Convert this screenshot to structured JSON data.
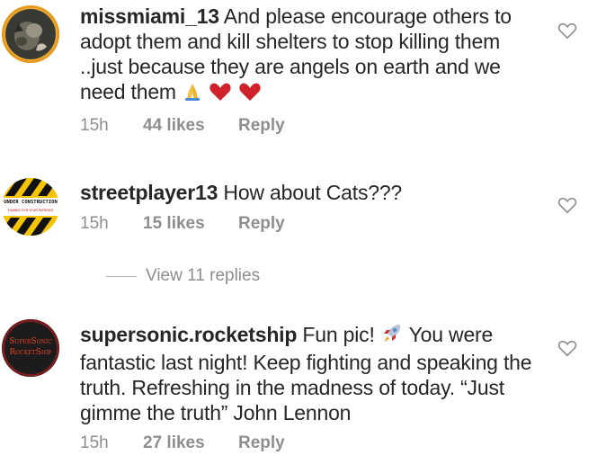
{
  "comments": [
    {
      "username": "missmiami_13",
      "text": "And please encourage others to adopt them and kill shelters to stop killing them ..just because they are angels on earth and we need them",
      "emojis": [
        "folded-hands-icon",
        "red-heart-icon",
        "red-heart-icon"
      ],
      "time": "15h",
      "likes": "44 likes",
      "reply": "Reply"
    },
    {
      "username": "streetplayer13",
      "text": "How about Cats???",
      "avatar_text_top": "UNDER CONSTRUCTION",
      "avatar_text_bottom": "THANKS FOR YOUR PATIENCE",
      "time": "15h",
      "likes": "15 likes",
      "reply": "Reply",
      "view_replies": "View 11 replies"
    },
    {
      "username": "supersonic.rocketship",
      "text_part1": "Fun pic!",
      "emoji": "rocket-icon",
      "text_part2": "You were fantastic last night!  Keep fighting and speaking the truth. Refreshing in the madness of today. “Just gimme the truth” John Lennon",
      "avatar_text_top": "SuperSonic",
      "avatar_text_bottom": "RocketShip",
      "time": "15h",
      "likes": "27 likes",
      "reply": "Reply"
    }
  ],
  "colors": {
    "text": "#262626",
    "meta": "#8e8e8e",
    "heart": "#ed4956",
    "ring": "#f5a300"
  }
}
